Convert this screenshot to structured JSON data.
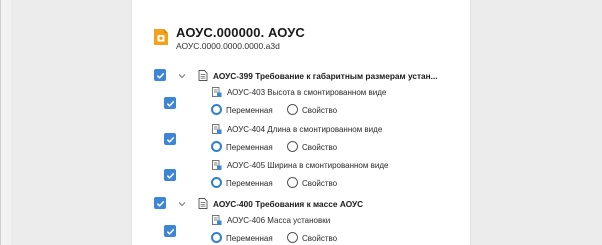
{
  "header": {
    "title": "АОУС.000000.  АОУС",
    "subtitle": "АОУС.0000.0000.0000.a3d"
  },
  "groups": [
    {
      "label": "АОУС-399  Требование к габаритным размерам устан...",
      "checked": true,
      "children": [
        {
          "label": "АОУС-403  Высота в смонтированном виде",
          "checked": true,
          "option_selected": "Переменная",
          "option_other": "Свойство"
        },
        {
          "label": "АОУС-404  Длина в смонтированном виде",
          "checked": true,
          "option_selected": "Переменная",
          "option_other": "Свойство"
        },
        {
          "label": "АОУС-405  Ширина в смонтированном виде",
          "checked": true,
          "option_selected": "Переменная",
          "option_other": "Свойство"
        }
      ]
    },
    {
      "label": "АОУС-400  Требования к массе АОУС",
      "checked": true,
      "children": [
        {
          "label": "АОУС-406  Масса установки",
          "checked": true,
          "option_selected": "Переменная",
          "option_other": "Свойство"
        }
      ]
    }
  ],
  "icons": {
    "header": "document-lock-icon",
    "group": "document-icon",
    "child": "requirement-icon",
    "expander": "chevron-down-icon",
    "checkbox": "checkmark-icon"
  },
  "colors": {
    "accent": "#3d86d6",
    "header_icon": "#f5a21b",
    "background": "#ececec",
    "panel": "#ffffff"
  }
}
